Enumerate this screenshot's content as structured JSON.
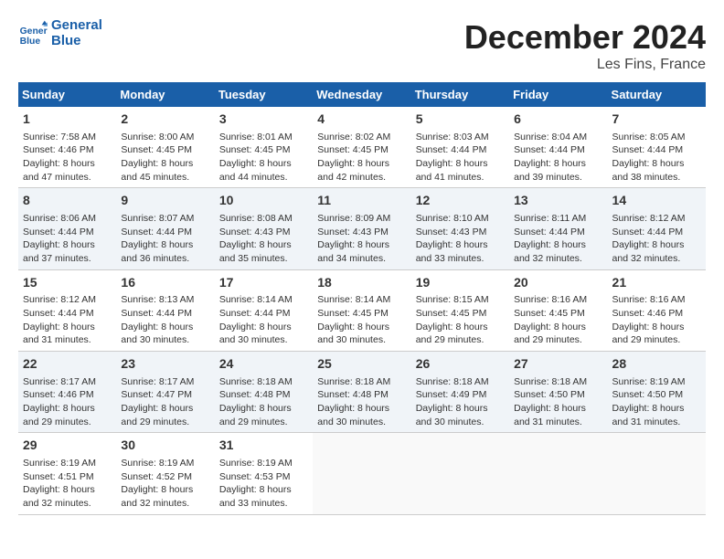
{
  "header": {
    "logo_line1": "General",
    "logo_line2": "Blue",
    "month": "December 2024",
    "location": "Les Fins, France"
  },
  "weekdays": [
    "Sunday",
    "Monday",
    "Tuesday",
    "Wednesday",
    "Thursday",
    "Friday",
    "Saturday"
  ],
  "weeks": [
    [
      {
        "day": "1",
        "info": "Sunrise: 7:58 AM\nSunset: 4:46 PM\nDaylight: 8 hours\nand 47 minutes."
      },
      {
        "day": "2",
        "info": "Sunrise: 8:00 AM\nSunset: 4:45 PM\nDaylight: 8 hours\nand 45 minutes."
      },
      {
        "day": "3",
        "info": "Sunrise: 8:01 AM\nSunset: 4:45 PM\nDaylight: 8 hours\nand 44 minutes."
      },
      {
        "day": "4",
        "info": "Sunrise: 8:02 AM\nSunset: 4:45 PM\nDaylight: 8 hours\nand 42 minutes."
      },
      {
        "day": "5",
        "info": "Sunrise: 8:03 AM\nSunset: 4:44 PM\nDaylight: 8 hours\nand 41 minutes."
      },
      {
        "day": "6",
        "info": "Sunrise: 8:04 AM\nSunset: 4:44 PM\nDaylight: 8 hours\nand 39 minutes."
      },
      {
        "day": "7",
        "info": "Sunrise: 8:05 AM\nSunset: 4:44 PM\nDaylight: 8 hours\nand 38 minutes."
      }
    ],
    [
      {
        "day": "8",
        "info": "Sunrise: 8:06 AM\nSunset: 4:44 PM\nDaylight: 8 hours\nand 37 minutes."
      },
      {
        "day": "9",
        "info": "Sunrise: 8:07 AM\nSunset: 4:44 PM\nDaylight: 8 hours\nand 36 minutes."
      },
      {
        "day": "10",
        "info": "Sunrise: 8:08 AM\nSunset: 4:43 PM\nDaylight: 8 hours\nand 35 minutes."
      },
      {
        "day": "11",
        "info": "Sunrise: 8:09 AM\nSunset: 4:43 PM\nDaylight: 8 hours\nand 34 minutes."
      },
      {
        "day": "12",
        "info": "Sunrise: 8:10 AM\nSunset: 4:43 PM\nDaylight: 8 hours\nand 33 minutes."
      },
      {
        "day": "13",
        "info": "Sunrise: 8:11 AM\nSunset: 4:44 PM\nDaylight: 8 hours\nand 32 minutes."
      },
      {
        "day": "14",
        "info": "Sunrise: 8:12 AM\nSunset: 4:44 PM\nDaylight: 8 hours\nand 32 minutes."
      }
    ],
    [
      {
        "day": "15",
        "info": "Sunrise: 8:12 AM\nSunset: 4:44 PM\nDaylight: 8 hours\nand 31 minutes."
      },
      {
        "day": "16",
        "info": "Sunrise: 8:13 AM\nSunset: 4:44 PM\nDaylight: 8 hours\nand 30 minutes."
      },
      {
        "day": "17",
        "info": "Sunrise: 8:14 AM\nSunset: 4:44 PM\nDaylight: 8 hours\nand 30 minutes."
      },
      {
        "day": "18",
        "info": "Sunrise: 8:14 AM\nSunset: 4:45 PM\nDaylight: 8 hours\nand 30 minutes."
      },
      {
        "day": "19",
        "info": "Sunrise: 8:15 AM\nSunset: 4:45 PM\nDaylight: 8 hours\nand 29 minutes."
      },
      {
        "day": "20",
        "info": "Sunrise: 8:16 AM\nSunset: 4:45 PM\nDaylight: 8 hours\nand 29 minutes."
      },
      {
        "day": "21",
        "info": "Sunrise: 8:16 AM\nSunset: 4:46 PM\nDaylight: 8 hours\nand 29 minutes."
      }
    ],
    [
      {
        "day": "22",
        "info": "Sunrise: 8:17 AM\nSunset: 4:46 PM\nDaylight: 8 hours\nand 29 minutes."
      },
      {
        "day": "23",
        "info": "Sunrise: 8:17 AM\nSunset: 4:47 PM\nDaylight: 8 hours\nand 29 minutes."
      },
      {
        "day": "24",
        "info": "Sunrise: 8:18 AM\nSunset: 4:48 PM\nDaylight: 8 hours\nand 29 minutes."
      },
      {
        "day": "25",
        "info": "Sunrise: 8:18 AM\nSunset: 4:48 PM\nDaylight: 8 hours\nand 30 minutes."
      },
      {
        "day": "26",
        "info": "Sunrise: 8:18 AM\nSunset: 4:49 PM\nDaylight: 8 hours\nand 30 minutes."
      },
      {
        "day": "27",
        "info": "Sunrise: 8:18 AM\nSunset: 4:50 PM\nDaylight: 8 hours\nand 31 minutes."
      },
      {
        "day": "28",
        "info": "Sunrise: 8:19 AM\nSunset: 4:50 PM\nDaylight: 8 hours\nand 31 minutes."
      }
    ],
    [
      {
        "day": "29",
        "info": "Sunrise: 8:19 AM\nSunset: 4:51 PM\nDaylight: 8 hours\nand 32 minutes."
      },
      {
        "day": "30",
        "info": "Sunrise: 8:19 AM\nSunset: 4:52 PM\nDaylight: 8 hours\nand 32 minutes."
      },
      {
        "day": "31",
        "info": "Sunrise: 8:19 AM\nSunset: 4:53 PM\nDaylight: 8 hours\nand 33 minutes."
      },
      {
        "day": "",
        "info": ""
      },
      {
        "day": "",
        "info": ""
      },
      {
        "day": "",
        "info": ""
      },
      {
        "day": "",
        "info": ""
      }
    ]
  ]
}
